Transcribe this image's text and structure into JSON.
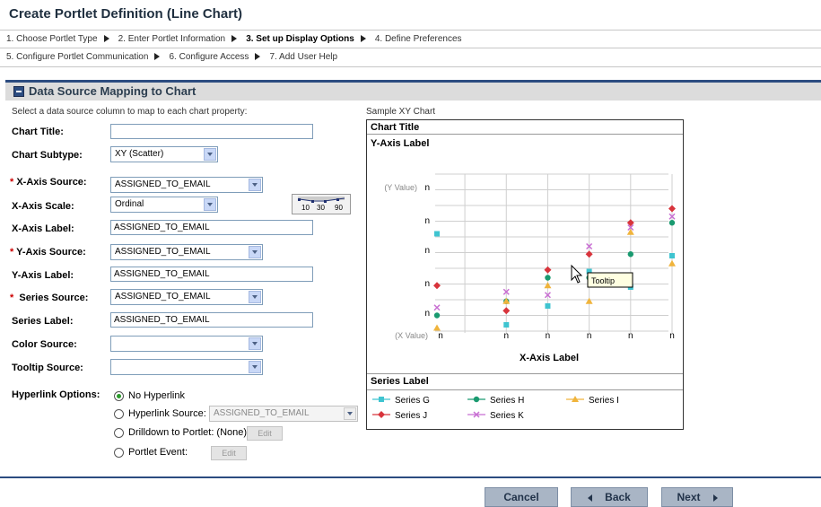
{
  "page_title": "Create Portlet Definition (Line Chart)",
  "steps_row1": [
    {
      "label": "1. Choose Portlet Type",
      "current": false
    },
    {
      "label": "2. Enter Portlet Information",
      "current": false
    },
    {
      "label": "3. Set up Display Options",
      "current": true
    },
    {
      "label": "4. Define Preferences",
      "current": false
    }
  ],
  "steps_row2": [
    {
      "label": "5. Configure Portlet Communication"
    },
    {
      "label": "6. Configure Access"
    },
    {
      "label": "7. Add User Help"
    }
  ],
  "section": {
    "title": "Data Source Mapping to Chart",
    "icon": "collapse-icon"
  },
  "instructions": "Select a data source column to map to each chart property:",
  "form": {
    "chart_title": {
      "label": "Chart Title:",
      "value": ""
    },
    "chart_subtype": {
      "label": "Chart Subtype:",
      "value": "XY (Scatter)"
    },
    "x_axis_source": {
      "label": "X-Axis Source:",
      "value": "ASSIGNED_TO_EMAIL",
      "required": true
    },
    "x_axis_scale": {
      "label": "X-Axis Scale:",
      "value": "Ordinal",
      "scale_ticks": [
        "10",
        "30",
        "90"
      ]
    },
    "x_axis_label": {
      "label": "X-Axis Label:",
      "value": "ASSIGNED_TO_EMAIL"
    },
    "y_axis_source": {
      "label": "Y-Axis Source:",
      "value": "ASSIGNED_TO_EMAIL",
      "required": true
    },
    "y_axis_label": {
      "label": "Y-Axis Label:",
      "value": "ASSIGNED_TO_EMAIL"
    },
    "series_source": {
      "label": "Series Source:",
      "value": "ASSIGNED_TO_EMAIL",
      "required": true
    },
    "series_label": {
      "label": "Series Label:",
      "value": "ASSIGNED_TO_EMAIL"
    },
    "color_source": {
      "label": "Color Source:",
      "value": ""
    },
    "tooltip_source": {
      "label": "Tooltip Source:",
      "value": ""
    },
    "required_mark": "*"
  },
  "hyperlink": {
    "label": "Hyperlink Options:",
    "options": [
      {
        "label": "No Hyperlink",
        "selected": true
      },
      {
        "label": "Hyperlink Source:",
        "selected": false,
        "select_value": "ASSIGNED_TO_EMAIL"
      },
      {
        "label": "Drilldown to Portlet: (None)",
        "selected": false,
        "button": "Edit"
      },
      {
        "label": "Portlet Event:",
        "selected": false,
        "button": "Edit"
      }
    ]
  },
  "sample": {
    "caption": "Sample XY Chart",
    "chart_title": "Chart Title",
    "y_axis_label": "Y-Axis Label",
    "x_axis_label": "X-Axis Label",
    "y_value_label": "(Y Value)",
    "x_value_label": "(X Value)",
    "tick_text": "n",
    "tooltip": "Tooltip",
    "series_label": "Series Label"
  },
  "chart_data": {
    "type": "scatter",
    "title": "Chart Title",
    "xlabel": "X-Axis Label",
    "ylabel": "Y-Axis Label",
    "x_tick_labels": [
      "n",
      "n",
      "n",
      "n",
      "n",
      "n"
    ],
    "y_tick_labels": [
      "n",
      "n",
      "n",
      "n",
      "n"
    ],
    "y_value_label": "(Y Value)",
    "x_value_label": "(X Value)",
    "xlim": [
      0,
      6
    ],
    "ylim": [
      0,
      10
    ],
    "grid": true,
    "legend_title": "Series Label",
    "legend_position": "bottom",
    "series": [
      {
        "name": "Series G",
        "color": "#3fc4d0",
        "marker": "square",
        "points": [
          [
            1,
            6.2
          ],
          [
            2,
            0.4
          ],
          [
            3,
            1.6
          ],
          [
            4,
            3.8
          ],
          [
            5,
            2.8
          ],
          [
            6,
            4.8
          ]
        ]
      },
      {
        "name": "Series H",
        "color": "#1a9a70",
        "marker": "circle",
        "points": [
          [
            1,
            1.0
          ],
          [
            2,
            1.9
          ],
          [
            3,
            3.4
          ],
          [
            4,
            3.4
          ],
          [
            5,
            4.9
          ],
          [
            6,
            6.9
          ]
        ]
      },
      {
        "name": "Series I",
        "color": "#f0b43c",
        "marker": "triangle",
        "points": [
          [
            1,
            0.2
          ],
          [
            2,
            1.9
          ],
          [
            3,
            2.9
          ],
          [
            4,
            1.9
          ],
          [
            5,
            6.3
          ],
          [
            6,
            4.3
          ]
        ]
      },
      {
        "name": "Series J",
        "color": "#d8343c",
        "marker": "diamond",
        "points": [
          [
            1,
            2.9
          ],
          [
            2,
            1.3
          ],
          [
            3,
            3.9
          ],
          [
            4,
            4.9
          ],
          [
            5,
            6.9
          ],
          [
            6,
            7.8
          ]
        ]
      },
      {
        "name": "Series K",
        "color": "#c86ed2",
        "marker": "x",
        "points": [
          [
            1,
            1.5
          ],
          [
            2,
            2.5
          ],
          [
            3,
            2.3
          ],
          [
            4,
            5.4
          ],
          [
            5,
            6.6
          ],
          [
            6,
            7.3
          ]
        ]
      }
    ]
  },
  "buttons": {
    "cancel": "Cancel",
    "back": "Back",
    "next": "Next"
  }
}
